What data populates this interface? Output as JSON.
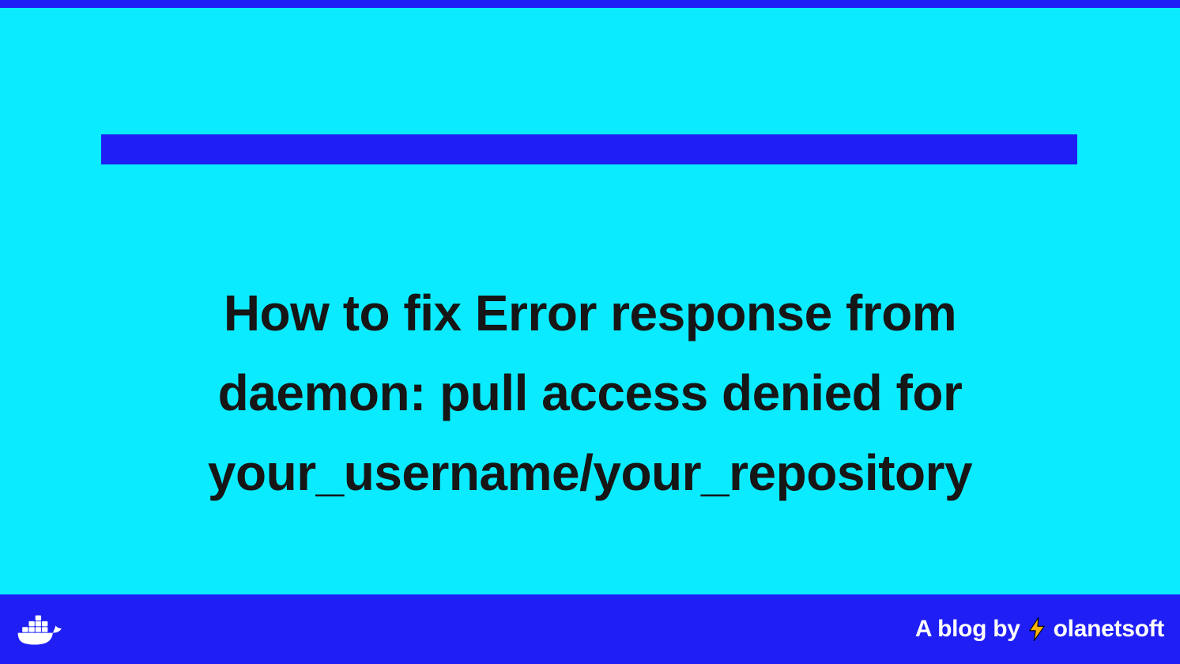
{
  "title": "How to fix Error response from daemon: pull access denied for your_username/your_repository",
  "footer": {
    "blog_by_label": "A blog by",
    "author": "olanetsoft"
  },
  "colors": {
    "background": "#0aebff",
    "accent": "#1f1ff5",
    "title_text": "#161616",
    "footer_text": "#ffffff"
  },
  "icons": {
    "docker_logo": "docker-whale-icon",
    "bolt": "lightning-bolt-icon"
  }
}
